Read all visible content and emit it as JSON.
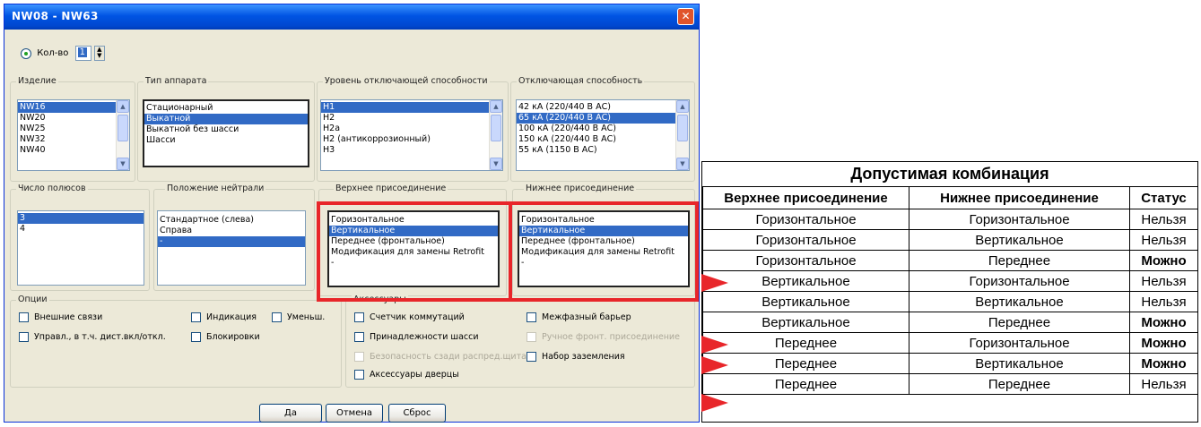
{
  "dialog": {
    "title": "NW08 - NW63",
    "close_glyph": "✕",
    "quantity": {
      "label": "Кол-во",
      "value": "1",
      "spin_up": "▲",
      "spin_down": "▼"
    },
    "product": {
      "label": "Изделие",
      "items": [
        "NW16",
        "NW20",
        "NW25",
        "NW32",
        "NW40"
      ],
      "selected": 0
    },
    "device_type": {
      "label": "Тип аппарата",
      "items": [
        "Стационарный",
        "Выкатной",
        "Выкатной без шасси",
        "Шасси"
      ],
      "selected": 1
    },
    "breaking_level": {
      "label": "Уровень отключающей способности",
      "items": [
        "H1",
        "H2",
        "H2a",
        "H2 (антикоррозионный)",
        "H3"
      ],
      "selected": 0
    },
    "breaking_capacity": {
      "label": "Отключающая способность",
      "items": [
        "42 кА (220/440 В АС)",
        "65 кА (220/440 В АС)",
        "100 кА (220/440 В АС)",
        "150 кА (220/440 В АС)",
        "55 кА (1150 В АС)"
      ],
      "selected": 1
    },
    "poles": {
      "label": "Число полюсов",
      "items": [
        "3",
        "4"
      ],
      "selected": 0
    },
    "neutral": {
      "label": "Положение нейтрали",
      "items": [
        "Стандартное (слева)",
        "Справа",
        "-"
      ],
      "selected": 2
    },
    "upper_connection": {
      "label": "Верхнее присоединение",
      "items": [
        "Горизонтальное",
        "Вертикальное",
        "Переднее (фронтальное)",
        "Модификация для замены Retrofit",
        "-"
      ],
      "selected": 1
    },
    "lower_connection": {
      "label": "Нижнее присоединение",
      "items": [
        "Горизонтальное",
        "Вертикальное",
        "Переднее (фронтальное)",
        "Модификация для замены Retrofit",
        "-"
      ],
      "selected": 1
    },
    "options": {
      "label": "Опции",
      "ext_links": "Внешние связи",
      "indication": "Индикация",
      "reduced": "Уменьш.",
      "control": "Управл., в т.ч. дист.вкл/откл.",
      "locks": "Блокировки"
    },
    "accessories": {
      "label": "Аксессуары",
      "op_counter": "Счетчик коммутаций",
      "phase_barrier": "Межфазный барьер",
      "chassis_acc": "Принадлежности шасси",
      "manual_front": "Ручное фронт. присоединение",
      "busbar_safety": "Безопасность сзади распред.щита",
      "earthing_kit": "Набор заземления",
      "door_acc": "Аксессуары дверцы"
    },
    "buttons": {
      "ok": "Да",
      "cancel": "Отмена",
      "reset": "Сброс"
    }
  },
  "combination_table": {
    "title": "Допустимая комбинация",
    "headers": [
      "Верхнее присоединение",
      "Нижнее присоединение",
      "Статус"
    ],
    "rows": [
      [
        "Горизонтальное",
        "Горизонтальное",
        "Нельзя"
      ],
      [
        "Горизонтальное",
        "Вертикальное",
        "Нельзя"
      ],
      [
        "Горизонтальное",
        "Переднее",
        "Можно"
      ],
      [
        "Вертикальное",
        "Горизонтальное",
        "Нельзя"
      ],
      [
        "Вертикальное",
        "Вертикальное",
        "Нельзя"
      ],
      [
        "Вертикальное",
        "Переднее",
        "Можно"
      ],
      [
        "Переднее",
        "Горизонтальное",
        "Можно"
      ],
      [
        "Переднее",
        "Вертикальное",
        "Можно"
      ],
      [
        "Переднее",
        "Переднее",
        "Нельзя"
      ]
    ],
    "highlight_color": "#e8262a"
  }
}
